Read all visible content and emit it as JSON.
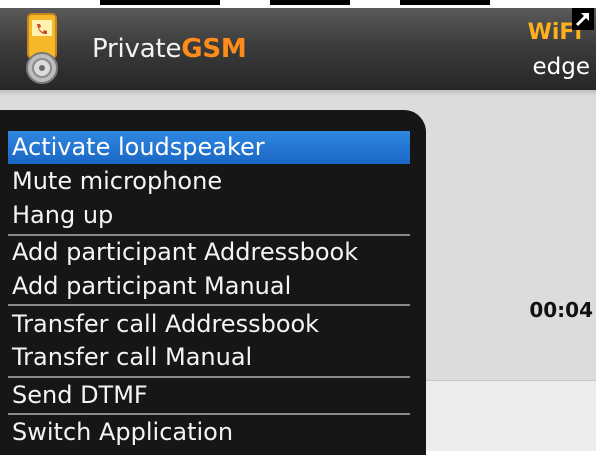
{
  "header": {
    "title_prefix": "Private",
    "title_brand": "GSM",
    "wifi_label": "WiFi",
    "network_label": "edge",
    "icons": [
      "phone-lock-app-icon",
      "expand-arrow-icon"
    ]
  },
  "call": {
    "timer": "00:04"
  },
  "menu": {
    "items": [
      {
        "label": "Activate loudspeaker",
        "selected": true
      },
      {
        "label": "Mute microphone"
      },
      {
        "label": "Hang up"
      },
      {
        "label": "Add participant Addressbook"
      },
      {
        "label": "Add participant Manual"
      },
      {
        "label": "Transfer call Addressbook"
      },
      {
        "label": "Transfer call Manual"
      },
      {
        "label": "Send DTMF"
      },
      {
        "label": "Switch Application"
      }
    ]
  },
  "colors": {
    "brand": "#ff8c1a",
    "highlight": "#1f74d2",
    "menu_bg": "#161616"
  }
}
